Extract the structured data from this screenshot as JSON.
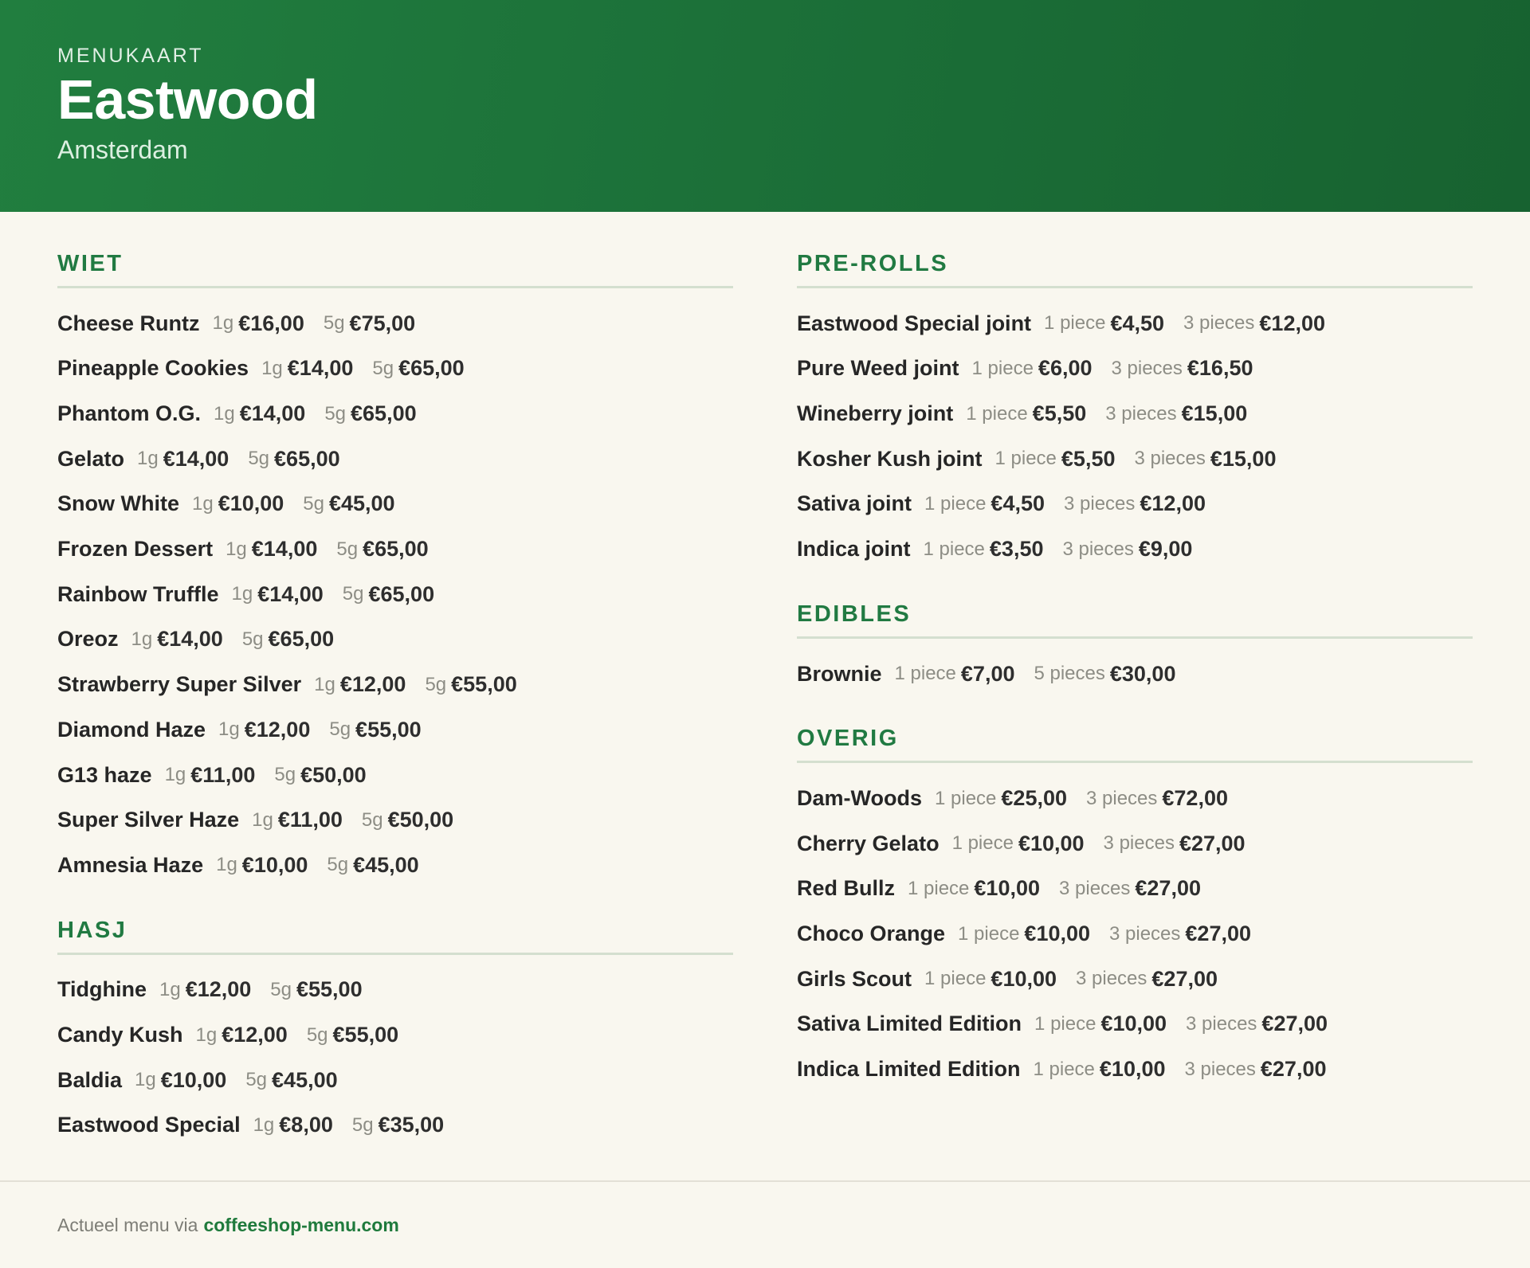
{
  "header": {
    "eyebrow": "MENUKAART",
    "title": "Eastwood",
    "subtitle": "Amsterdam"
  },
  "sections": {
    "wiet": {
      "title": "WIET",
      "items": [
        {
          "name": "Cheese Runtz",
          "q1": "1g",
          "p1": "€16,00",
          "q2": "5g",
          "p2": "€75,00"
        },
        {
          "name": "Pineapple Cookies",
          "q1": "1g",
          "p1": "€14,00",
          "q2": "5g",
          "p2": "€65,00"
        },
        {
          "name": "Phantom O.G.",
          "q1": "1g",
          "p1": "€14,00",
          "q2": "5g",
          "p2": "€65,00"
        },
        {
          "name": "Gelato",
          "q1": "1g",
          "p1": "€14,00",
          "q2": "5g",
          "p2": "€65,00"
        },
        {
          "name": "Snow White",
          "q1": "1g",
          "p1": "€10,00",
          "q2": "5g",
          "p2": "€45,00"
        },
        {
          "name": "Frozen Dessert",
          "q1": "1g",
          "p1": "€14,00",
          "q2": "5g",
          "p2": "€65,00"
        },
        {
          "name": "Rainbow Truffle",
          "q1": "1g",
          "p1": "€14,00",
          "q2": "5g",
          "p2": "€65,00"
        },
        {
          "name": "Oreoz",
          "q1": "1g",
          "p1": "€14,00",
          "q2": "5g",
          "p2": "€65,00"
        },
        {
          "name": "Strawberry Super Silver",
          "q1": "1g",
          "p1": "€12,00",
          "q2": "5g",
          "p2": "€55,00"
        },
        {
          "name": "Diamond Haze",
          "q1": "1g",
          "p1": "€12,00",
          "q2": "5g",
          "p2": "€55,00"
        },
        {
          "name": "G13 haze",
          "q1": "1g",
          "p1": "€11,00",
          "q2": "5g",
          "p2": "€50,00"
        },
        {
          "name": "Super Silver Haze",
          "q1": "1g",
          "p1": "€11,00",
          "q2": "5g",
          "p2": "€50,00"
        },
        {
          "name": "Amnesia Haze",
          "q1": "1g",
          "p1": "€10,00",
          "q2": "5g",
          "p2": "€45,00"
        }
      ]
    },
    "hasj": {
      "title": "HASJ",
      "items": [
        {
          "name": "Tidghine",
          "q1": "1g",
          "p1": "€12,00",
          "q2": "5g",
          "p2": "€55,00"
        },
        {
          "name": "Candy Kush",
          "q1": "1g",
          "p1": "€12,00",
          "q2": "5g",
          "p2": "€55,00"
        },
        {
          "name": "Baldia",
          "q1": "1g",
          "p1": "€10,00",
          "q2": "5g",
          "p2": "€45,00"
        },
        {
          "name": "Eastwood Special",
          "q1": "1g",
          "p1": "€8,00",
          "q2": "5g",
          "p2": "€35,00"
        }
      ]
    },
    "prerolls": {
      "title": "PRE-ROLLS",
      "items": [
        {
          "name": "Eastwood Special joint",
          "q1": "1 piece",
          "p1": "€4,50",
          "q2": "3 pieces",
          "p2": "€12,00"
        },
        {
          "name": "Pure Weed joint",
          "q1": "1 piece",
          "p1": "€6,00",
          "q2": "3 pieces",
          "p2": "€16,50"
        },
        {
          "name": "Wineberry joint",
          "q1": "1 piece",
          "p1": "€5,50",
          "q2": "3 pieces",
          "p2": "€15,00"
        },
        {
          "name": "Kosher Kush joint",
          "q1": "1 piece",
          "p1": "€5,50",
          "q2": "3 pieces",
          "p2": "€15,00"
        },
        {
          "name": "Sativa joint",
          "q1": "1 piece",
          "p1": "€4,50",
          "q2": "3 pieces",
          "p2": "€12,00"
        },
        {
          "name": "Indica joint",
          "q1": "1 piece",
          "p1": "€3,50",
          "q2": "3 pieces",
          "p2": "€9,00"
        }
      ]
    },
    "edibles": {
      "title": "EDIBLES",
      "items": [
        {
          "name": "Brownie",
          "q1": "1 piece",
          "p1": "€7,00",
          "q2": "5 pieces",
          "p2": "€30,00"
        }
      ]
    },
    "overig": {
      "title": "OVERIG",
      "items": [
        {
          "name": "Dam-Woods",
          "q1": "1 piece",
          "p1": "€25,00",
          "q2": "3 pieces",
          "p2": "€72,00"
        },
        {
          "name": "Cherry Gelato",
          "q1": "1 piece",
          "p1": "€10,00",
          "q2": "3 pieces",
          "p2": "€27,00"
        },
        {
          "name": "Red Bullz",
          "q1": "1 piece",
          "p1": "€10,00",
          "q2": "3 pieces",
          "p2": "€27,00"
        },
        {
          "name": "Choco Orange",
          "q1": "1 piece",
          "p1": "€10,00",
          "q2": "3 pieces",
          "p2": "€27,00"
        },
        {
          "name": "Girls Scout",
          "q1": "1 piece",
          "p1": "€10,00",
          "q2": "3 pieces",
          "p2": "€27,00"
        },
        {
          "name": "Sativa Limited Edition",
          "q1": "1 piece",
          "p1": "€10,00",
          "q2": "3 pieces",
          "p2": "€27,00"
        },
        {
          "name": "Indica Limited Edition",
          "q1": "1 piece",
          "p1": "€10,00",
          "q2": "3 pieces",
          "p2": "€27,00"
        }
      ]
    }
  },
  "footer": {
    "text": "Actueel menu via",
    "link": "coffeeshop-menu.com"
  },
  "colors": {
    "brand_green": "#1c7139",
    "section_title": "#217a42",
    "background": "#f9f7ef"
  }
}
